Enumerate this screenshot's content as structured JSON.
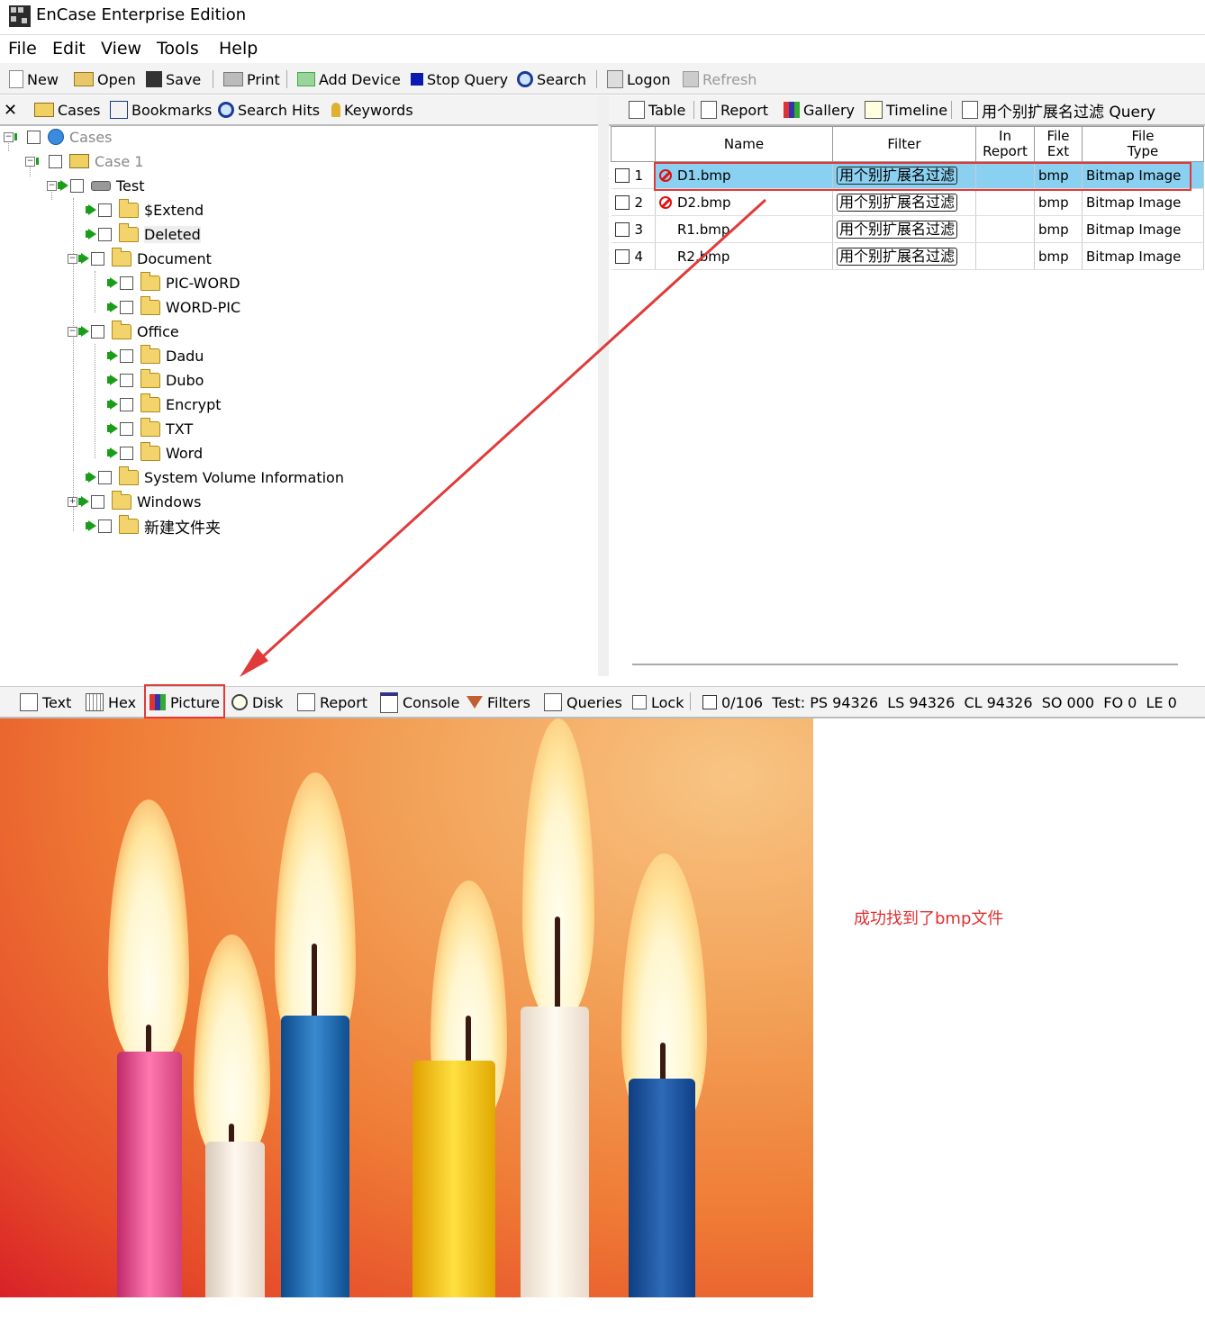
{
  "window": {
    "title": "EnCase Enterprise Edition"
  },
  "menu": [
    "File",
    "Edit",
    "View",
    "Tools",
    "Help"
  ],
  "toolbar": {
    "new": "New",
    "open": "Open",
    "save": "Save",
    "print": "Print",
    "add_device": "Add Device",
    "stop_query": "Stop Query",
    "search": "Search",
    "logon": "Logon",
    "refresh": "Refresh"
  },
  "left_tabs": {
    "close": "✕",
    "cases": "Cases",
    "bookmarks": "Bookmarks",
    "search_hits": "Search Hits",
    "keywords": "Keywords"
  },
  "tree": {
    "root": "Cases",
    "case": "Case 1",
    "device": "Test",
    "folders": {
      "extend": "$Extend",
      "deleted": "Deleted",
      "document": "Document",
      "pic_word": "PIC-WORD",
      "word_pic": "WORD-PIC",
      "office": "Office",
      "dadu": "Dadu",
      "dubo": "Dubo",
      "encrypt": "Encrypt",
      "txt": "TXT",
      "word": "Word",
      "svi": "System Volume Information",
      "windows": "Windows",
      "new_folder": "新建文件夹"
    }
  },
  "right_tabs": {
    "table": "Table",
    "report": "Report",
    "gallery": "Gallery",
    "timeline": "Timeline",
    "query": "用个别扩展名过滤 Query"
  },
  "table": {
    "headers": {
      "name": "Name",
      "filter": "Filter",
      "in_report_1": "In",
      "in_report_2": "Report",
      "file_ext_1": "File",
      "file_ext_2": "Ext",
      "file_type_1": "File",
      "file_type_2": "Type"
    },
    "rows": [
      {
        "num": "1",
        "name": "D1.bmp",
        "filter": "用个别扩展名过滤",
        "ext": "bmp",
        "type": "Bitmap Image"
      },
      {
        "num": "2",
        "name": "D2.bmp",
        "filter": "用个别扩展名过滤",
        "ext": "bmp",
        "type": "Bitmap Image"
      },
      {
        "num": "3",
        "name": "R1.bmp",
        "filter": "用个别扩展名过滤",
        "ext": "bmp",
        "type": "Bitmap Image"
      },
      {
        "num": "4",
        "name": "R2.bmp",
        "filter": "用个别扩展名过滤",
        "ext": "bmp",
        "type": "Bitmap Image"
      }
    ]
  },
  "view_tabs": {
    "text": "Text",
    "hex": "Hex",
    "picture": "Picture",
    "disk": "Disk",
    "report": "Report",
    "console": "Console",
    "filters": "Filters",
    "queries": "Queries",
    "lock": "Lock"
  },
  "status": "0/106  Test: PS 94326  LS 94326  CL 94326  SO 000  FO 0  LE 0",
  "annotation": "成功找到了bmp文件",
  "colors": {
    "annotation_red": "#e03a3a",
    "selection": "#8ad0f0",
    "tree_arrow": "#1a9e1a"
  }
}
